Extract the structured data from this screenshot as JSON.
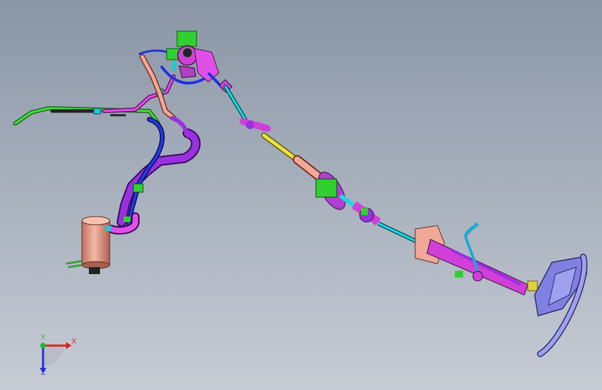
{
  "viewport": {
    "background_top": "#8a96a6",
    "background_bottom": "#c7ccd5"
  },
  "triad": {
    "x_label": "X",
    "y_label": "Y",
    "z_label": "Z",
    "x_color": "#e0201a",
    "y_color": "#19b83b",
    "z_color": "#2430d8"
  },
  "colors": {
    "magenta": "#d040d8",
    "purple": "#8a2ad0",
    "blue": "#2030e0",
    "green": "#30d030",
    "salmon": "#e8a090",
    "cyan": "#20d8e0",
    "yellow": "#f0e040",
    "lavender": "#8080e0"
  }
}
